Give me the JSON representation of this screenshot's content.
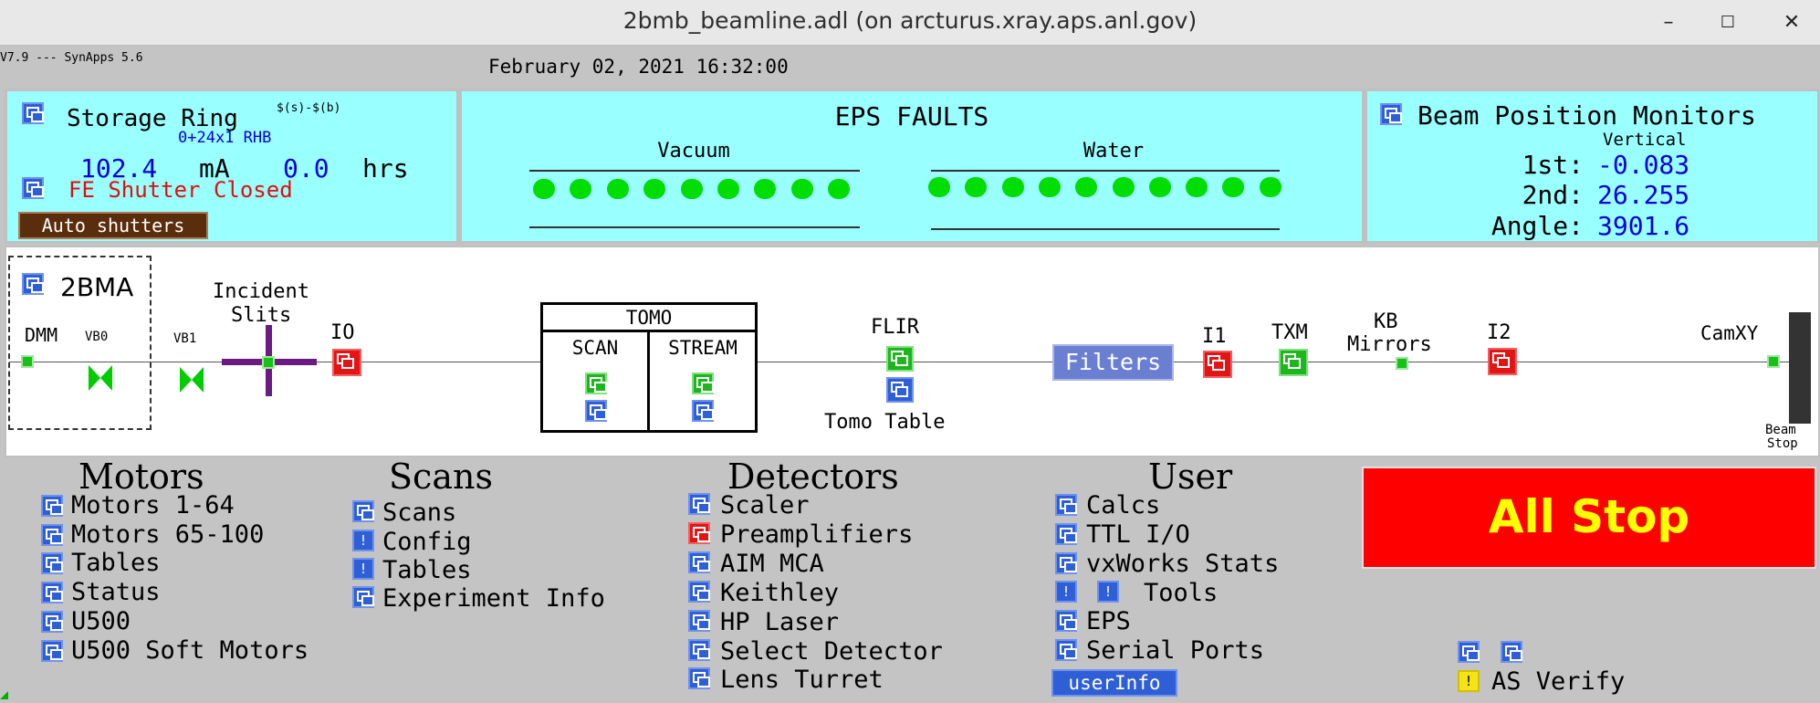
{
  "window": {
    "title": "2bmb_beamline.adl (on arcturus.xray.aps.anl.gov)",
    "minimize": "–",
    "maximize": "☐",
    "close": "✕"
  },
  "version": "V7.9 --- SynApps 5.6",
  "datetime": "February 02, 2021 16:32:00",
  "storage_ring": {
    "title": "Storage Ring",
    "formula": "$(s)-$(b)",
    "mode": "0+24x1 RHB",
    "current": "102.4",
    "current_unit": "mA",
    "lifetime": "0.0",
    "lifetime_unit": "hrs",
    "shutter_status": "FE Shutter Closed",
    "auto_shutters": "Auto shutters"
  },
  "eps": {
    "title": "EPS FAULTS",
    "vacuum": "Vacuum",
    "water": "Water",
    "vacuum_dots": 9,
    "water_dots": 10
  },
  "bpm": {
    "title": "Beam Position Monitors",
    "subtitle": "Vertical",
    "rows": [
      {
        "label": "1st:",
        "value": "-0.083"
      },
      {
        "label": "2nd:",
        "value": "26.255"
      },
      {
        "label": "Angle:",
        "value": "3901.6"
      }
    ]
  },
  "beamline": {
    "hutch": "2BMA",
    "dmm": "DMM",
    "vb0": "VB0",
    "vb1": "VB1",
    "incident": "Incident",
    "slits": "Slits",
    "io": "IO",
    "tomo": "TOMO",
    "scan": "SCAN",
    "stream": "STREAM",
    "flir": "FLIR",
    "tomo_table": "Tomo Table",
    "filters": "Filters",
    "i1": "I1",
    "txm": "TXM",
    "kb": "KB",
    "mirrors": "Mirrors",
    "i2": "I2",
    "camxy": "CamXY",
    "beam": "Beam",
    "stop": "Stop"
  },
  "menus": {
    "motors": {
      "heading": "Motors",
      "items": [
        "Motors 1-64",
        "Motors 65-100",
        "Tables",
        "Status",
        "U500",
        "U500 Soft Motors"
      ]
    },
    "scans": {
      "heading": "Scans",
      "items": [
        "Scans",
        "Config",
        "Tables",
        "Experiment Info"
      ]
    },
    "detectors": {
      "heading": "Detectors",
      "items": [
        "Scaler",
        "Preamplifiers",
        "AIM MCA",
        "Keithley",
        "HP Laser",
        "Select Detector",
        "Lens Turret"
      ]
    },
    "user": {
      "heading": "User",
      "items": [
        "Calcs",
        "TTL I/O",
        "vxWorks Stats",
        "Tools",
        "EPS",
        "Serial Ports"
      ],
      "userinfo": "userInfo"
    }
  },
  "all_stop": "All Stop",
  "as_verify": "AS Verify",
  "colors": {
    "panel": "#99ffff",
    "all_stop_bg": "#ff0000",
    "all_stop_text": "#ffff00",
    "background": "#c4c4c4"
  }
}
